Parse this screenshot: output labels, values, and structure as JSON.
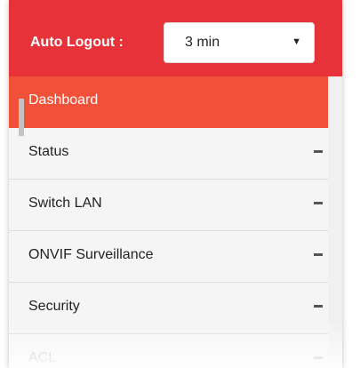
{
  "header": {
    "auto_logout_label": "Auto Logout :",
    "auto_logout_value": "3 min",
    "color": "#e8323a"
  },
  "menu": {
    "items": [
      {
        "label": "Dashboard",
        "active": true
      },
      {
        "label": "Status",
        "active": false
      },
      {
        "label": "Switch LAN",
        "active": false
      },
      {
        "label": "ONVIF Surveillance",
        "active": false
      },
      {
        "label": "Security",
        "active": false
      },
      {
        "label": "ACL",
        "active": false
      }
    ],
    "active_color": "#f25139"
  }
}
